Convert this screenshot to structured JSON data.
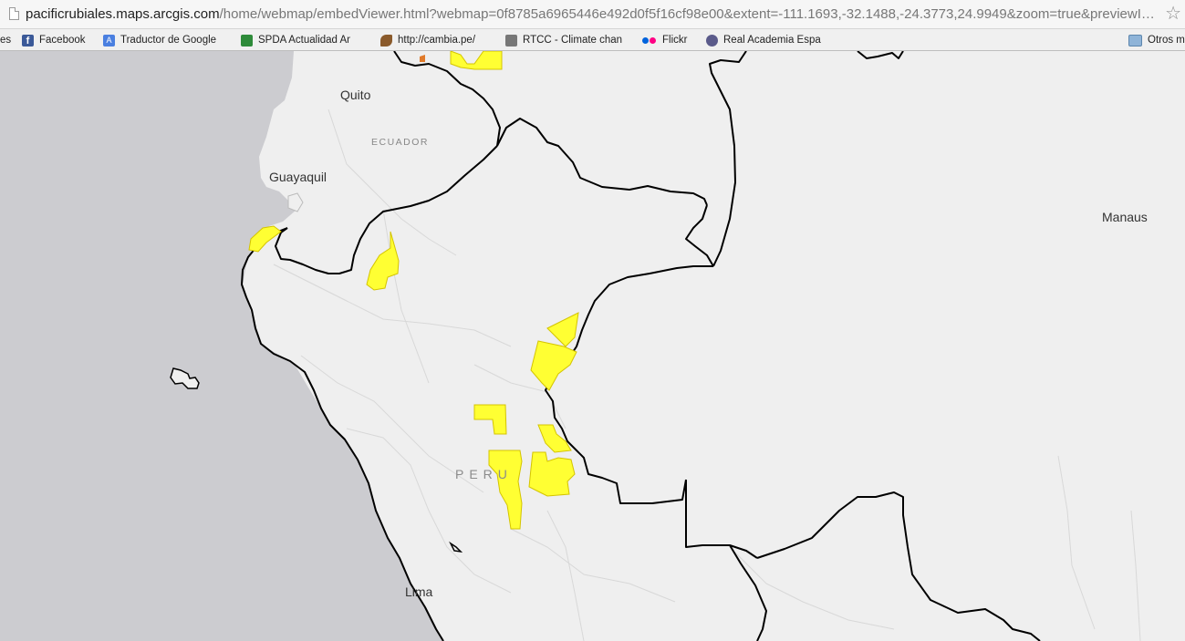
{
  "browser": {
    "url_host": "pacificrubiales.maps.arcgis.com",
    "url_path": "/home/webmap/embedViewer.html?webmap=0f8785a6965446e492d0f5f16cf98e00&extent=-111.1693,-32.1488,-24.3773,24.9949&zoom=true&previewImage=false&scale=true&disable_scroll=true&theme=light",
    "star_icon": "bookmark-star-icon",
    "bookmarks": [
      {
        "label": "es",
        "icon": "none"
      },
      {
        "label": "Facebook",
        "icon": "facebook-icon",
        "color": "#3b5998"
      },
      {
        "label": "Traductor de Google",
        "icon": "google-translate-icon",
        "color": "#4a7fe0"
      },
      {
        "label": "SPDA Actualidad Am",
        "icon": "spda-icon",
        "color": "#2e8b3a"
      },
      {
        "label": "http://cambia.pe/",
        "icon": "cambia-icon",
        "color": "#8a5a2b"
      },
      {
        "label": "RTCC - Climate chan",
        "icon": "rtcc-icon",
        "color": "#777777"
      },
      {
        "label": "Flickr",
        "icon": "flickr-icon",
        "color": "#ff0084"
      },
      {
        "label": "Real Academia Espa",
        "icon": "rae-icon",
        "color": "#5a5a8a"
      },
      {
        "label": "Otros m",
        "icon": "folder-icon",
        "color": "#8fb4d8"
      }
    ]
  },
  "map": {
    "colors": {
      "land": "#efefef",
      "ocean": "#ccccd0",
      "border": "#000000",
      "admin_lines": "#d8d8d8",
      "blocks": "#ffff33",
      "block_outline": "#d4c400",
      "marker": "#e07a2a"
    },
    "cities": [
      "Quito",
      "Guayaquil",
      "Manaus",
      "Lima"
    ],
    "countries": [
      "ECUADOR",
      "PERU"
    ]
  }
}
